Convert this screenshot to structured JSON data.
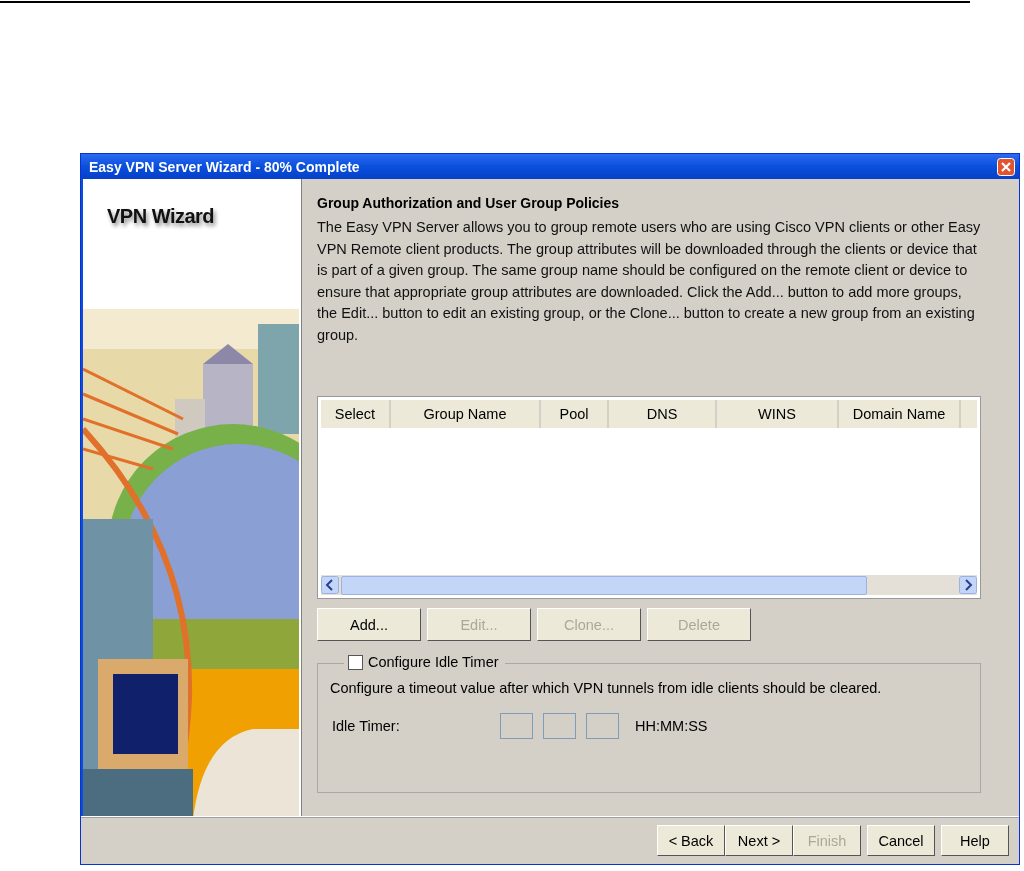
{
  "window": {
    "title": "Easy VPN Server Wizard - 80% Complete"
  },
  "sidebar": {
    "title": "VPN Wizard"
  },
  "section": {
    "heading": "Group Authorization and User Group Policies",
    "description": "The Easy VPN Server allows you to group remote users who are using Cisco VPN clients or other Easy VPN Remote client products. The group attributes will be downloaded through the clients or device that is part of a given group. The same group name should be configured on the remote client or device to ensure that appropriate group attributes are downloaded. Click the Add... button to add more groups, the Edit... button to edit an existing group, or the Clone... button to create a new group from an existing group."
  },
  "table": {
    "columns": [
      "Select",
      "Group Name",
      "Pool",
      "DNS",
      "WINS",
      "Domain Name"
    ]
  },
  "table_buttons": [
    {
      "label": "Add...",
      "disabled": false
    },
    {
      "label": "Edit...",
      "disabled": true
    },
    {
      "label": "Clone...",
      "disabled": true
    },
    {
      "label": "Delete",
      "disabled": true
    }
  ],
  "idle_timer": {
    "label": "Configure Idle Timer",
    "checked": false,
    "description": "Configure a timeout value after which VPN tunnels from idle clients should be cleared.",
    "field_label": "Idle Timer:",
    "format": "HH:MM:SS"
  },
  "footer_buttons": [
    {
      "label": "< Back",
      "disabled": false
    },
    {
      "label": "Next >",
      "disabled": false
    },
    {
      "label": "Finish",
      "disabled": true
    },
    {
      "label": "Cancel",
      "disabled": false
    },
    {
      "label": "Help",
      "disabled": false
    }
  ]
}
